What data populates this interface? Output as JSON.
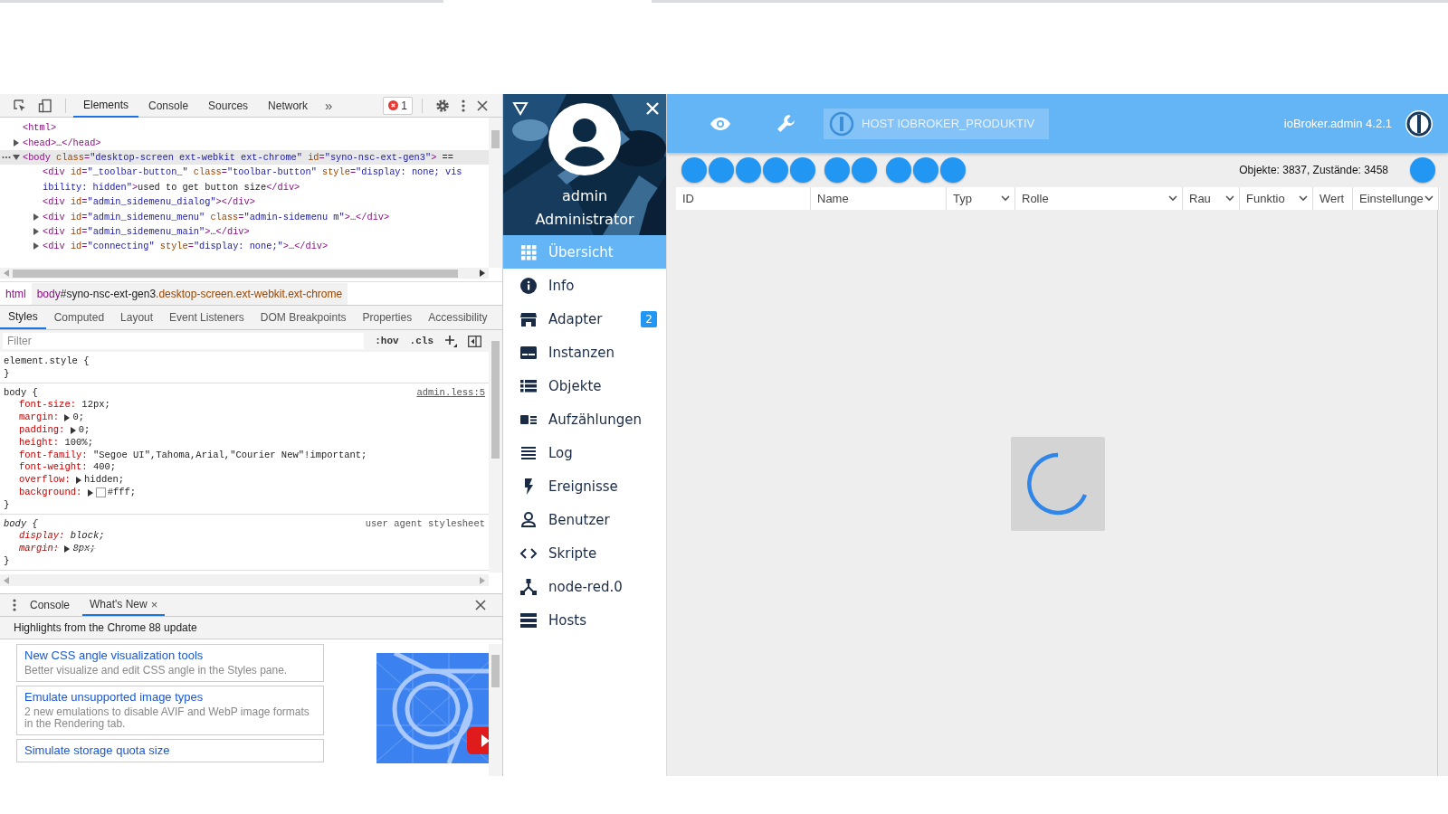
{
  "devtools": {
    "tabs": [
      {
        "label": "Elements",
        "selected": true
      },
      {
        "label": "Console",
        "selected": false
      },
      {
        "label": "Sources",
        "selected": false
      },
      {
        "label": "Network",
        "selected": false
      }
    ],
    "more": "»",
    "errors": "1",
    "tree": [
      {
        "expandable": false,
        "indent": false,
        "selected": false,
        "tokens": [
          {
            "kind": "tag",
            "text": "<html>"
          }
        ]
      },
      {
        "expandable": true,
        "expanded": false,
        "indent": false,
        "selected": false,
        "tokens": [
          {
            "kind": "tag",
            "text": "<head>"
          },
          {
            "kind": "text",
            "text": "…"
          },
          {
            "kind": "tag",
            "text": "</head>"
          }
        ]
      },
      {
        "expandable": true,
        "expanded": true,
        "indent": false,
        "selected": true,
        "tokens": [
          {
            "kind": "tag",
            "text": "<body"
          },
          {
            "kind": "attr",
            "text": " class"
          },
          {
            "kind": "tag",
            "text": "="
          },
          {
            "kind": "value",
            "text": "\"desktop-screen ext-webkit ext-chrome\""
          },
          {
            "kind": "attr",
            "text": " id"
          },
          {
            "kind": "tag",
            "text": "="
          },
          {
            "kind": "value",
            "text": "\"syno-nsc-ext-gen3\""
          },
          {
            "kind": "tag",
            "text": ">"
          },
          {
            "kind": "text",
            "text": " =="
          }
        ]
      },
      {
        "expandable": false,
        "indent": true,
        "selected": false,
        "tokens": [
          {
            "kind": "tag",
            "text": "<div"
          },
          {
            "kind": "attr",
            "text": " id"
          },
          {
            "kind": "tag",
            "text": "="
          },
          {
            "kind": "value",
            "text": "\"_toolbar-button_\""
          },
          {
            "kind": "attr",
            "text": " class"
          },
          {
            "kind": "tag",
            "text": "="
          },
          {
            "kind": "value",
            "text": "\"toolbar-button\""
          },
          {
            "kind": "attr",
            "text": " style"
          },
          {
            "kind": "tag",
            "text": "="
          },
          {
            "kind": "value",
            "text": "\"display: none; vis"
          }
        ]
      },
      {
        "expandable": false,
        "indent": true,
        "selected": false,
        "tokens": [
          {
            "kind": "value",
            "text": "ibility: hidden\""
          },
          {
            "kind": "tag",
            "text": ">"
          },
          {
            "kind": "text",
            "text": "used to get button size"
          },
          {
            "kind": "tag",
            "text": "</div>"
          }
        ]
      },
      {
        "expandable": false,
        "indent": true,
        "selected": false,
        "tokens": [
          {
            "kind": "tag",
            "text": "<div"
          },
          {
            "kind": "attr",
            "text": " id"
          },
          {
            "kind": "tag",
            "text": "="
          },
          {
            "kind": "value",
            "text": "\"admin_sidemenu_dialog\""
          },
          {
            "kind": "tag",
            "text": "></div>"
          }
        ]
      },
      {
        "expandable": true,
        "expanded": false,
        "indent": true,
        "selected": false,
        "tokens": [
          {
            "kind": "tag",
            "text": "<div"
          },
          {
            "kind": "attr",
            "text": " id"
          },
          {
            "kind": "tag",
            "text": "="
          },
          {
            "kind": "value",
            "text": "\"admin_sidemenu_menu\""
          },
          {
            "kind": "attr",
            "text": " class"
          },
          {
            "kind": "tag",
            "text": "="
          },
          {
            "kind": "value",
            "text": "\"admin-sidemenu m\""
          },
          {
            "kind": "tag",
            "text": ">"
          },
          {
            "kind": "text",
            "text": "…"
          },
          {
            "kind": "tag",
            "text": "</div>"
          }
        ]
      },
      {
        "expandable": true,
        "expanded": false,
        "indent": true,
        "selected": false,
        "tokens": [
          {
            "kind": "tag",
            "text": "<div"
          },
          {
            "kind": "attr",
            "text": " id"
          },
          {
            "kind": "tag",
            "text": "="
          },
          {
            "kind": "value",
            "text": "\"admin_sidemenu_main\""
          },
          {
            "kind": "tag",
            "text": ">"
          },
          {
            "kind": "text",
            "text": "…"
          },
          {
            "kind": "tag",
            "text": "</div>"
          }
        ]
      },
      {
        "expandable": true,
        "expanded": false,
        "indent": true,
        "selected": false,
        "tokens": [
          {
            "kind": "tag",
            "text": "<div"
          },
          {
            "kind": "attr",
            "text": " id"
          },
          {
            "kind": "tag",
            "text": "="
          },
          {
            "kind": "value",
            "text": "\"connecting\""
          },
          {
            "kind": "attr",
            "text": " style"
          },
          {
            "kind": "tag",
            "text": "="
          },
          {
            "kind": "value",
            "text": "\"display: none;\""
          },
          {
            "kind": "tag",
            "text": ">"
          },
          {
            "kind": "text",
            "text": "…"
          },
          {
            "kind": "tag",
            "text": "</div>"
          }
        ]
      }
    ],
    "breadcrumbs": [
      {
        "tag": "html",
        "selected": false
      },
      {
        "tag": "body",
        "id": "#syno-nsc-ext-gen3",
        "classes": ".desktop-screen.ext-webkit.ext-chrome",
        "selected": true
      }
    ],
    "pane_tabs": [
      {
        "label": "Styles",
        "selected": true
      },
      {
        "label": "Computed",
        "selected": false
      },
      {
        "label": "Layout",
        "selected": false
      },
      {
        "label": "Event Listeners",
        "selected": false
      },
      {
        "label": "DOM Breakpoints",
        "selected": false
      },
      {
        "label": "Properties",
        "selected": false
      },
      {
        "label": "Accessibility",
        "selected": false
      }
    ],
    "filter": {
      "placeholder": "Filter"
    },
    "hov": ":hov",
    "cls": ".cls",
    "rules": [
      {
        "selector": "element.style {",
        "close": "}",
        "italic": false
      },
      {
        "selector": "body {",
        "close": "}",
        "source": "admin.less:5",
        "italic": false,
        "props": [
          {
            "property": "font-size:",
            "value": "12px;",
            "expandable": false,
            "overridden": false,
            "swatch": false
          },
          {
            "property": "margin:",
            "value": "0;",
            "expandable": true,
            "overridden": false,
            "swatch": false
          },
          {
            "property": "padding:",
            "value": "0;",
            "expandable": true,
            "overridden": false,
            "swatch": false
          },
          {
            "property": "height:",
            "value": "100%;",
            "expandable": false,
            "overridden": false,
            "swatch": false
          },
          {
            "property": "font-family:",
            "value": "\"Segoe UI\",Tahoma,Arial,\"Courier New\"!important;",
            "expandable": false,
            "overridden": false,
            "swatch": false
          },
          {
            "property": "font-weight:",
            "value": "400;",
            "expandable": false,
            "overridden": false,
            "swatch": false
          },
          {
            "property": "overflow:",
            "value": "hidden;",
            "expandable": true,
            "overridden": false,
            "swatch": false
          },
          {
            "property": "background:",
            "value": "#fff;",
            "expandable": true,
            "overridden": false,
            "swatch": true
          }
        ]
      },
      {
        "selector": "body {",
        "close": "}",
        "source": "user agent stylesheet",
        "italic": true,
        "props": [
          {
            "property": "display:",
            "value": "block;",
            "expandable": false,
            "overridden": false,
            "swatch": false
          },
          {
            "property": "margin:",
            "value": "8px;",
            "expandable": true,
            "overridden": true,
            "swatch": false
          }
        ]
      }
    ],
    "drawer_tabs": [
      {
        "label": "Console",
        "selected": false,
        "closable": false
      },
      {
        "label": "What's New",
        "selected": true,
        "closable": true
      }
    ],
    "close_glyph": "×",
    "highlights": "Highlights from the Chrome 88 update",
    "cards": [
      {
        "title": "New CSS angle visualization tools",
        "description": "Better visualize and edit CSS angle in the Styles pane."
      },
      {
        "title": "Emulate unsupported image types",
        "description": "2 new emulations to disable AVIF and WebP image formats in the Rendering tab."
      },
      {
        "title": "Simulate storage quota size"
      }
    ]
  },
  "sidebar": {
    "user": "admin",
    "role": "Administrator",
    "items": [
      {
        "label": "Übersicht",
        "selected": true
      },
      {
        "label": "Info",
        "selected": false
      },
      {
        "label": "Adapter",
        "selected": false,
        "badge": "2"
      },
      {
        "label": "Instanzen",
        "selected": false
      },
      {
        "label": "Objekte",
        "selected": false
      },
      {
        "label": "Aufzählungen",
        "selected": false
      },
      {
        "label": "Log",
        "selected": false
      },
      {
        "label": "Ereignisse",
        "selected": false
      },
      {
        "label": "Benutzer",
        "selected": false
      },
      {
        "label": "Skripte",
        "selected": false
      },
      {
        "label": "node-red.0",
        "selected": false
      },
      {
        "label": "Hosts",
        "selected": false
      }
    ]
  },
  "header": {
    "host": "HOST IOBROKER_PRODUKTIV",
    "host_disabled": true,
    "version": "ioBroker.admin 4.2.1"
  },
  "toolbar": {
    "groups": [
      {
        "buttons": [
          {
            "disabled": false
          },
          {
            "disabled": false
          },
          {
            "disabled": false
          },
          {
            "disabled": false
          },
          {
            "disabled": false
          }
        ]
      },
      {
        "buttons": [
          {
            "disabled": false
          },
          {
            "disabled": false
          }
        ]
      },
      {
        "buttons": [
          {
            "disabled": false
          },
          {
            "disabled": false
          },
          {
            "disabled": false
          }
        ]
      }
    ],
    "counts": "Objekte: 3837, Zustände: 3458"
  },
  "table": {
    "columns": [
      {
        "label": "ID",
        "filter": false
      },
      {
        "label": "Name",
        "filter": false
      },
      {
        "label": "Typ",
        "filter": true
      },
      {
        "label": "Rolle",
        "filter": true
      },
      {
        "label": "Rau",
        "filter": true
      },
      {
        "label": "Funktio",
        "filter": true
      },
      {
        "label": "Wert",
        "filter": false
      },
      {
        "label": "Einstellunge",
        "filter": true
      }
    ],
    "loading": true
  }
}
